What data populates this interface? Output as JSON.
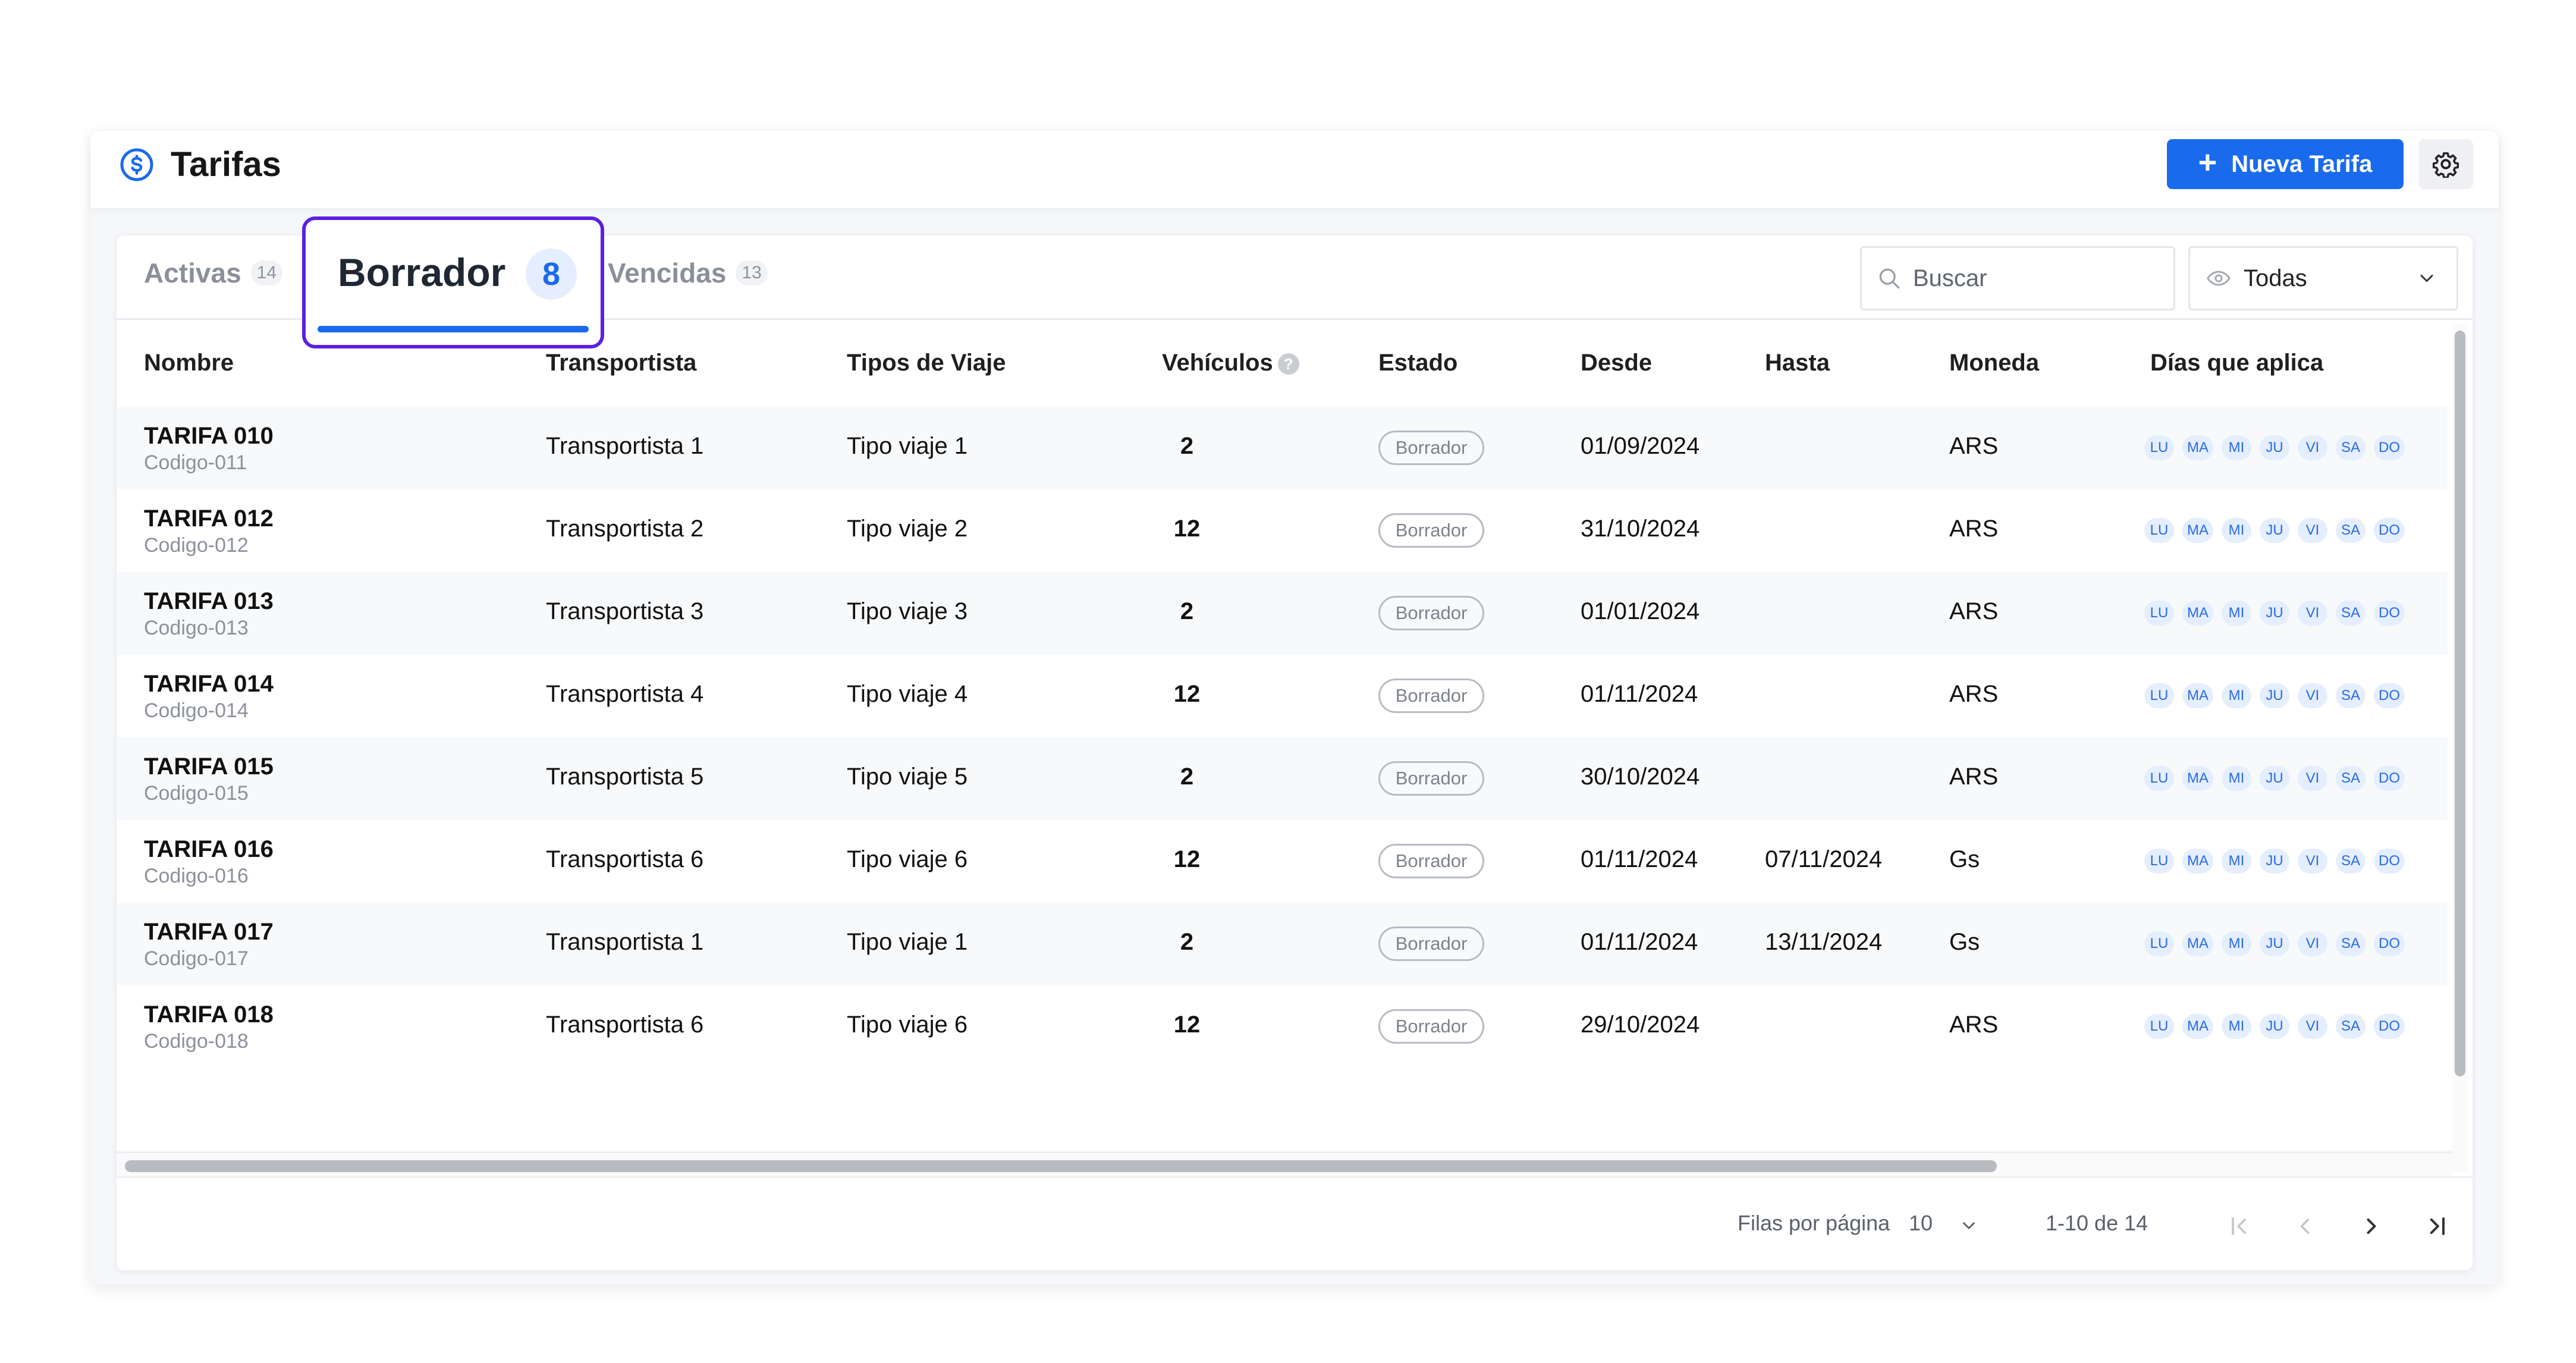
{
  "header": {
    "title": "Tarifas",
    "title_icon": "dollar-circle-icon",
    "new_button_label": "Nueva Tarifa",
    "settings_icon": "gear-icon"
  },
  "tabs": [
    {
      "label": "Activas",
      "count": "14",
      "active": false
    },
    {
      "label": "Borrador",
      "count": "8",
      "active": true
    },
    {
      "label": "Vencidas",
      "count": "13",
      "active": false
    }
  ],
  "search": {
    "placeholder": "Buscar"
  },
  "filter": {
    "value": "Todas",
    "icon": "eye-icon"
  },
  "columns": {
    "nombre": "Nombre",
    "transportista": "Transportista",
    "tipos": "Tipos de Viaje",
    "vehiculos": "Vehículos",
    "estado": "Estado",
    "desde": "Desde",
    "hasta": "Hasta",
    "moneda": "Moneda",
    "dias": "Días que aplica"
  },
  "days": [
    "LU",
    "MA",
    "MI",
    "JU",
    "VI",
    "SA",
    "DO"
  ],
  "rows": [
    {
      "name": "TARIFA 010",
      "code": "Codigo-011",
      "transportista": "Transportista 1",
      "tipo": "Tipo viaje 1",
      "vehiculos": "2",
      "estado": "Borrador",
      "desde": "01/09/2024",
      "hasta": "",
      "moneda": "ARS"
    },
    {
      "name": "TARIFA 012",
      "code": "Codigo-012",
      "transportista": "Transportista 2",
      "tipo": "Tipo viaje 2",
      "vehiculos": "12",
      "estado": "Borrador",
      "desde": "31/10/2024",
      "hasta": "",
      "moneda": "ARS"
    },
    {
      "name": "TARIFA 013",
      "code": "Codigo-013",
      "transportista": "Transportista 3",
      "tipo": "Tipo viaje 3",
      "vehiculos": "2",
      "estado": "Borrador",
      "desde": "01/01/2024",
      "hasta": "",
      "moneda": "ARS"
    },
    {
      "name": "TARIFA 014",
      "code": "Codigo-014",
      "transportista": "Transportista 4",
      "tipo": "Tipo viaje 4",
      "vehiculos": "12",
      "estado": "Borrador",
      "desde": "01/11/2024",
      "hasta": "",
      "moneda": "ARS"
    },
    {
      "name": "TARIFA 015",
      "code": "Codigo-015",
      "transportista": "Transportista 5",
      "tipo": "Tipo viaje 5",
      "vehiculos": "2",
      "estado": "Borrador",
      "desde": "30/10/2024",
      "hasta": "",
      "moneda": "ARS"
    },
    {
      "name": "TARIFA 016",
      "code": "Codigo-016",
      "transportista": "Transportista 6",
      "tipo": "Tipo viaje 6",
      "vehiculos": "12",
      "estado": "Borrador",
      "desde": "01/11/2024",
      "hasta": "07/11/2024",
      "moneda": "Gs"
    },
    {
      "name": "TARIFA 017",
      "code": "Codigo-017",
      "transportista": "Transportista 1",
      "tipo": "Tipo viaje 1",
      "vehiculos": "2",
      "estado": "Borrador",
      "desde": "01/11/2024",
      "hasta": "13/11/2024",
      "moneda": "Gs"
    },
    {
      "name": "TARIFA 018",
      "code": "Codigo-018",
      "transportista": "Transportista 6",
      "tipo": "Tipo viaje 6",
      "vehiculos": "12",
      "estado": "Borrador",
      "desde": "29/10/2024",
      "hasta": "",
      "moneda": "ARS"
    }
  ],
  "pagination": {
    "rows_per_page_label": "Filas por página",
    "rows_per_page": "10",
    "range": "1-10 de 14"
  },
  "colors": {
    "accent": "#1a6aed",
    "highlight_border": "#5b21e0",
    "day_chip_bg": "#e4eefe",
    "status_border": "#b7bcc3"
  }
}
